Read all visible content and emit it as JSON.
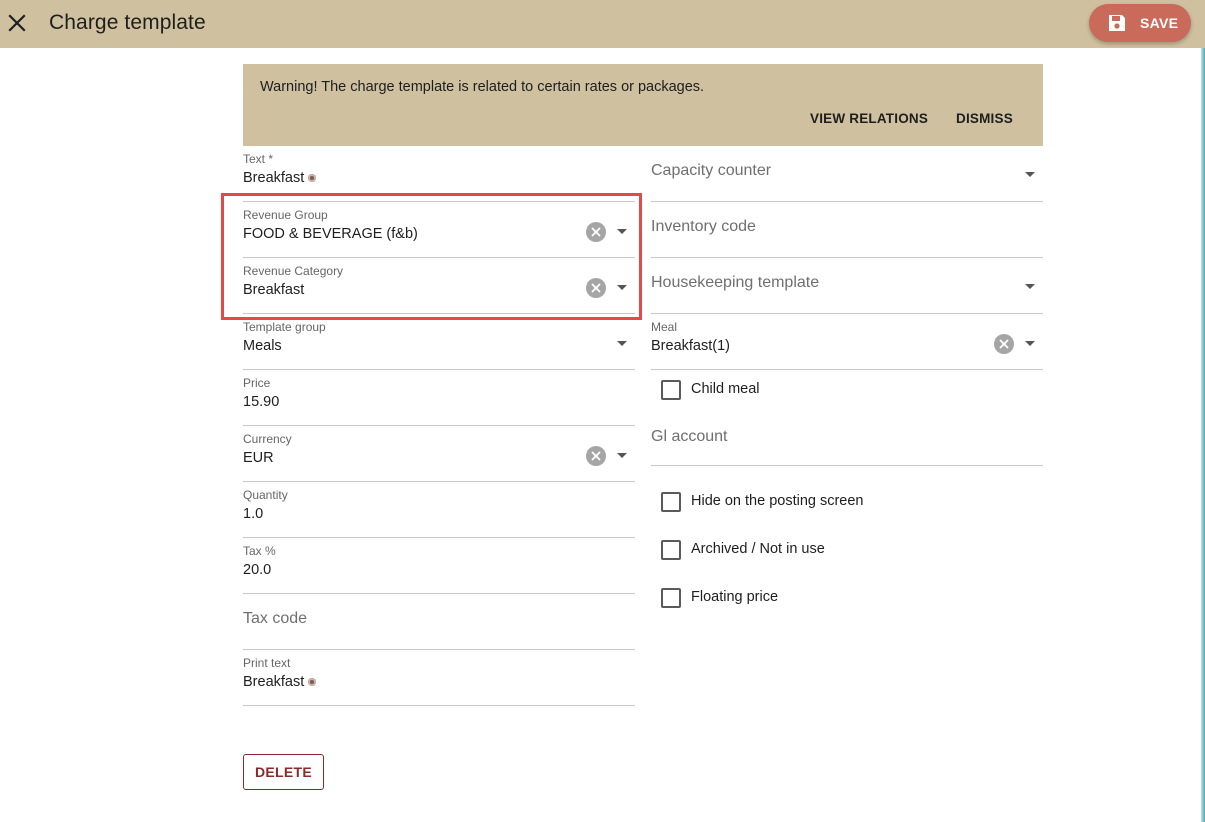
{
  "header": {
    "title": "Charge template",
    "save_label": "SAVE",
    "accent_color": "#cfc1a0",
    "save_color": "#c96a5a"
  },
  "warning": {
    "message": "Warning! The charge template is related to certain rates or packages.",
    "view_relations_label": "VIEW RELATIONS",
    "dismiss_label": "DISMISS"
  },
  "left_fields": {
    "text": {
      "label": "Text *",
      "value": "Breakfast"
    },
    "revenue_group": {
      "label": "Revenue Group",
      "value": "FOOD & BEVERAGE (f&b)"
    },
    "revenue_category": {
      "label": "Revenue Category",
      "value": "Breakfast"
    },
    "template_group": {
      "label": "Template group",
      "value": "Meals"
    },
    "price": {
      "label": "Price",
      "value": "15.90"
    },
    "currency": {
      "label": "Currency",
      "value": "EUR"
    },
    "quantity": {
      "label": "Quantity",
      "value": "1.0"
    },
    "tax_percent": {
      "label": "Tax %",
      "value": "20.0"
    },
    "tax_code": {
      "placeholder": "Tax code"
    },
    "print_text": {
      "label": "Print text",
      "value": "Breakfast"
    }
  },
  "right_fields": {
    "capacity_counter": {
      "placeholder": "Capacity counter"
    },
    "inventory_code": {
      "placeholder": "Inventory code"
    },
    "housekeeping_template": {
      "placeholder": "Housekeeping template"
    },
    "meal": {
      "label": "Meal",
      "value": "Breakfast(1)"
    },
    "child_meal": {
      "label": "Child meal",
      "checked": false
    },
    "gl_account": {
      "placeholder": "Gl account"
    },
    "hide_on_posting": {
      "label": "Hide on the posting screen",
      "checked": false
    },
    "archived": {
      "label": "Archived / Not in use",
      "checked": false
    },
    "floating_price": {
      "label": "Floating price",
      "checked": false
    }
  },
  "footer": {
    "delete_label": "DELETE"
  }
}
